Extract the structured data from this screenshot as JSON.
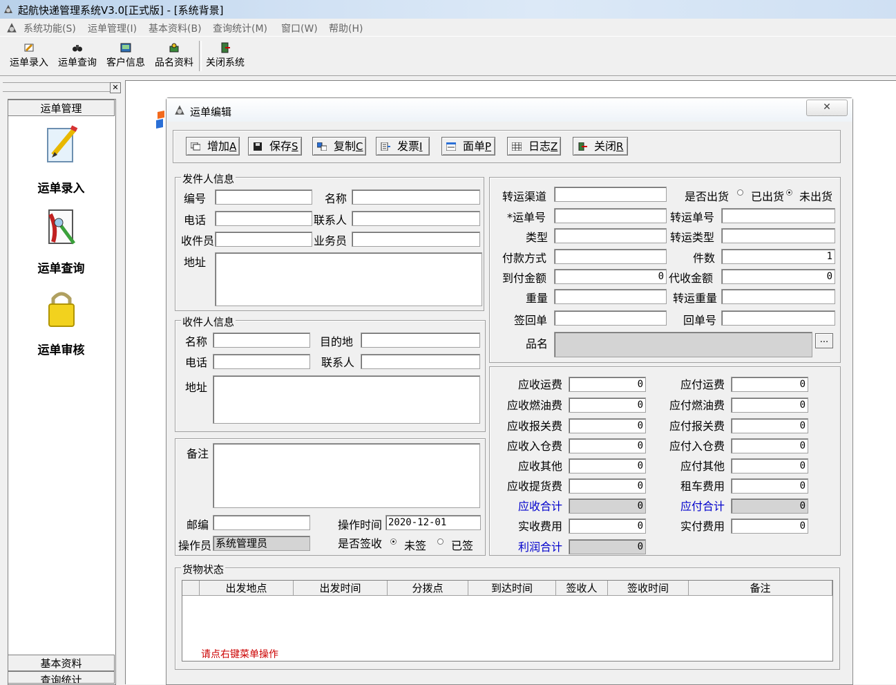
{
  "window": {
    "title": "起航快递管理系统V3.0[正式版] - [系统背景]"
  },
  "menu": [
    "系统功能(S)",
    "运单管理(I)",
    "基本资料(B)",
    "查询统计(M)",
    "窗口(W)",
    "帮助(H)"
  ],
  "toolbar": [
    "运单录入",
    "运单查询",
    "客户信息",
    "品名资料",
    "关闭系统"
  ],
  "sidebar": {
    "header": "运单管理",
    "items": [
      "运单录入",
      "运单查询",
      "运单审核"
    ],
    "bottom": [
      "基本资料",
      "查询统计"
    ]
  },
  "dialog": {
    "title": "运单编辑",
    "close_glyph": "✕",
    "buttons": [
      {
        "label": "增加",
        "key": "A"
      },
      {
        "label": "保存",
        "key": "S"
      },
      {
        "label": "复制",
        "key": "C"
      },
      {
        "label": "发票",
        "key": "I"
      },
      {
        "label": "面单",
        "key": "P"
      },
      {
        "label": "日志",
        "key": "Z"
      },
      {
        "label": "关闭",
        "key": "R"
      }
    ]
  },
  "sender": {
    "legend": "发件人信息",
    "code": "编号",
    "name": "名称",
    "phone": "电话",
    "contact": "联系人",
    "collector": "收件员",
    "salesman": "业务员",
    "address": "地址"
  },
  "receiver": {
    "legend": "收件人信息",
    "name": "名称",
    "dest": "目的地",
    "phone": "电话",
    "contact": "联系人",
    "address": "地址"
  },
  "remarks": {
    "label": "备注",
    "zip": "邮编",
    "optime_label": "操作时间",
    "optime": "2020-12-01",
    "operator_label": "操作员",
    "operator": "系统管理员",
    "signed_label": "是否签收",
    "signed_no": "未签",
    "signed_yes": "已签"
  },
  "shipment": {
    "channel": "转运渠道",
    "shipped_label": "是否出货",
    "shipped": "已出货",
    "not_shipped": "未出货",
    "waybill": "*运单号",
    "transfer_no": "转运单号",
    "type": "类型",
    "transfer_type": "转运类型",
    "pay": "付款方式",
    "pieces_label": "件数",
    "pieces": "1",
    "cod_label": "到付金额",
    "cod": "0",
    "collect_label": "代收金额",
    "collect": "0",
    "weight": "重量",
    "transfer_weight": "转运重量",
    "return_sign": "签回单",
    "return_no": "回单号",
    "goods": "品名",
    "browse": "..."
  },
  "fees": {
    "left": [
      {
        "label": "应收运费",
        "value": "0"
      },
      {
        "label": "应收燃油费",
        "value": "0"
      },
      {
        "label": "应收报关费",
        "value": "0"
      },
      {
        "label": "应收入仓费",
        "value": "0"
      },
      {
        "label": "应收其他",
        "value": "0"
      },
      {
        "label": "应收提货费",
        "value": "0"
      },
      {
        "label": "应收合计",
        "value": "0"
      },
      {
        "label": "实收费用",
        "value": "0"
      },
      {
        "label": "利润合计",
        "value": "0"
      }
    ],
    "right": [
      {
        "label": "应付运费",
        "value": "0"
      },
      {
        "label": "应付燃油费",
        "value": "0"
      },
      {
        "label": "应付报关费",
        "value": "0"
      },
      {
        "label": "应付入仓费",
        "value": "0"
      },
      {
        "label": "应付其他",
        "value": "0"
      },
      {
        "label": "租车费用",
        "value": "0"
      },
      {
        "label": "应付合计",
        "value": "0"
      },
      {
        "label": "实付费用",
        "value": "0"
      }
    ]
  },
  "goods_status": {
    "legend": "货物状态",
    "columns": [
      "出发地点",
      "出发时间",
      "分拨点",
      "到达时间",
      "签收人",
      "签收时间",
      "备注"
    ],
    "hint": "请点右键菜单操作"
  }
}
